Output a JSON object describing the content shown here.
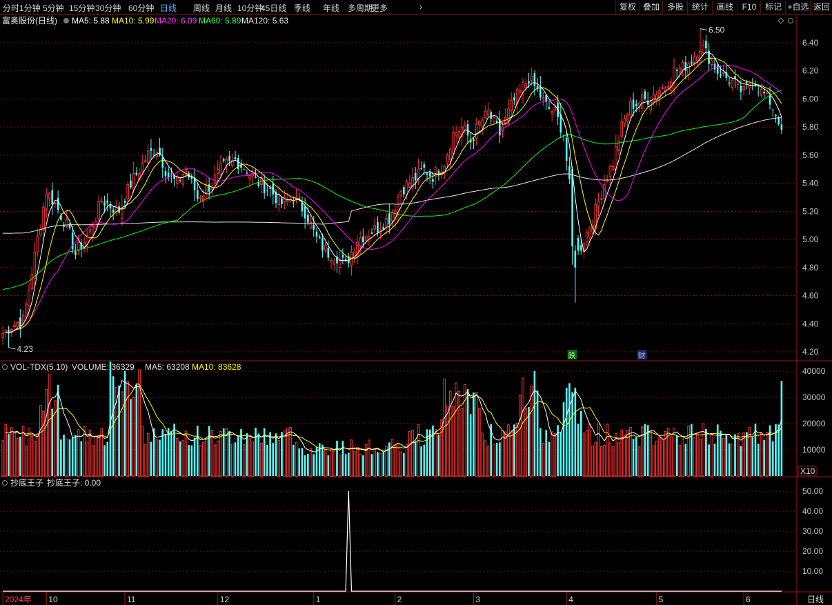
{
  "toolbar": {
    "periods": [
      "分时",
      "1分钟",
      "5分钟",
      "15分钟",
      "30分钟",
      "60分钟",
      "日线",
      "周线",
      "月线",
      "10分钟",
      "45日线",
      "季线",
      "年线",
      "多周期",
      "更多"
    ],
    "active_period": "日线",
    "buttons": [
      "复权",
      "叠加",
      "多股",
      "统计",
      "画线",
      "F10",
      "标记",
      "+自选",
      "返回"
    ]
  },
  "colors": {
    "up": "#ff3232",
    "down": "#54ffff",
    "ma5": "#ffffff",
    "ma10": "#ffff00",
    "ma20": "#ff00ff",
    "ma60": "#00ff00",
    "ma120": "#e8e8e8",
    "grid": "#7a1010",
    "axis_text": "#c8c8c8"
  },
  "price_panel": {
    "title": "富奥股份(日线)",
    "indicators": [
      {
        "label": "MA5: 5.88",
        "color": "#ffffff"
      },
      {
        "label": "MA10: 5.99",
        "color": "#ffff00"
      },
      {
        "label": "MA20: 6.09",
        "color": "#ff33ff"
      },
      {
        "label": "MA60: 5.89",
        "color": "#33ff33"
      },
      {
        "label": "MA120: 5.63",
        "color": "#e8e8e8"
      }
    ],
    "axis_ticks": [
      "6.40",
      "6.20",
      "6.00",
      "5.80",
      "5.60",
      "5.40",
      "5.20",
      "5.00",
      "4.80",
      "4.60",
      "4.40",
      "4.20"
    ],
    "high_label": "6.50",
    "low_label": "4.23",
    "event_tags": [
      {
        "text": "跌",
        "index": 196
      },
      {
        "text": "财",
        "index": 220
      }
    ]
  },
  "volume_panel": {
    "title": "VOL-TDX(5,10)",
    "indicators": [
      {
        "label": "VOLUME: 36329",
        "color": "#e0e0e0"
      },
      {
        "label": "MA5: 63208",
        "color": "#e0e0e0"
      },
      {
        "label": "MA10: 83628",
        "color": "#ffff00"
      }
    ],
    "axis_ticks": [
      "40000",
      "30000",
      "20000",
      "10000"
    ],
    "unit_label": "X10"
  },
  "indicator_panel": {
    "title": "抄底王子",
    "indicators": [
      {
        "label": "抄底王子: 0.00",
        "color": "#e0e0e0"
      }
    ],
    "axis_ticks": [
      "50.00",
      "40.00",
      "30.00",
      "20.00",
      "10.00"
    ]
  },
  "bottom_axis": {
    "labels": [
      {
        "text": "2024年",
        "index": 0
      },
      {
        "text": "10",
        "index": 15
      },
      {
        "text": "11",
        "index": 42
      },
      {
        "text": "12",
        "index": 74
      },
      {
        "text": "1",
        "index": 107
      },
      {
        "text": "2",
        "index": 135
      },
      {
        "text": "3",
        "index": 162
      },
      {
        "text": "4",
        "index": 194
      },
      {
        "text": "5",
        "index": 225
      },
      {
        "text": "6",
        "index": 255
      }
    ],
    "period_label": "日线"
  },
  "chart_data": {
    "type": "candlestick",
    "title": "富奥股份(日线)",
    "price_range": [
      4.18,
      6.55
    ],
    "volume_range": [
      0,
      42000
    ],
    "indicator_range": [
      0,
      55
    ],
    "anchors": [
      [
        0,
        4.33
      ],
      [
        4,
        4.4
      ],
      [
        7,
        4.42
      ],
      [
        12,
        5.0
      ],
      [
        15,
        5.35
      ],
      [
        18,
        5.25
      ],
      [
        22,
        5.1
      ],
      [
        25,
        4.9
      ],
      [
        30,
        5.05
      ],
      [
        34,
        5.28
      ],
      [
        40,
        5.2
      ],
      [
        44,
        5.4
      ],
      [
        50,
        5.6
      ],
      [
        53,
        5.65
      ],
      [
        57,
        5.45
      ],
      [
        60,
        5.4
      ],
      [
        63,
        5.5
      ],
      [
        67,
        5.3
      ],
      [
        72,
        5.4
      ],
      [
        76,
        5.52
      ],
      [
        80,
        5.56
      ],
      [
        84,
        5.5
      ],
      [
        87,
        5.42
      ],
      [
        92,
        5.35
      ],
      [
        96,
        5.25
      ],
      [
        100,
        5.3
      ],
      [
        104,
        5.2
      ],
      [
        108,
        5.0
      ],
      [
        112,
        4.9
      ],
      [
        115,
        4.88
      ],
      [
        118,
        4.82
      ],
      [
        122,
        5.0
      ],
      [
        126,
        5.05
      ],
      [
        130,
        5.1
      ],
      [
        133,
        5.15
      ],
      [
        137,
        5.35
      ],
      [
        141,
        5.42
      ],
      [
        145,
        5.5
      ],
      [
        148,
        5.45
      ],
      [
        152,
        5.55
      ],
      [
        155,
        5.75
      ],
      [
        158,
        5.8
      ],
      [
        161,
        5.7
      ],
      [
        164,
        5.82
      ],
      [
        167,
        5.9
      ],
      [
        171,
        5.75
      ],
      [
        175,
        5.95
      ],
      [
        178,
        6.05
      ],
      [
        181,
        6.15
      ],
      [
        184,
        6.05
      ],
      [
        187,
        5.95
      ],
      [
        190,
        5.9
      ],
      [
        193,
        5.75
      ],
      [
        196,
        5.2
      ],
      [
        198,
        4.9
      ],
      [
        201,
        5.05
      ],
      [
        204,
        5.2
      ],
      [
        207,
        5.4
      ],
      [
        210,
        5.55
      ],
      [
        213,
        5.8
      ],
      [
        216,
        5.95
      ],
      [
        219,
        5.98
      ],
      [
        222,
        6.0
      ],
      [
        225,
        6.05
      ],
      [
        228,
        6.1
      ],
      [
        231,
        6.2
      ],
      [
        234,
        6.22
      ],
      [
        237,
        6.28
      ],
      [
        240,
        6.38
      ],
      [
        243,
        6.3
      ],
      [
        246,
        6.2
      ],
      [
        249,
        6.15
      ],
      [
        252,
        6.1
      ],
      [
        255,
        6.05
      ],
      [
        258,
        6.15
      ],
      [
        261,
        6.05
      ],
      [
        264,
        5.98
      ],
      [
        267,
        5.85
      ],
      [
        268,
        5.78
      ]
    ],
    "last_bar": {
      "close": 5.78,
      "volume": 36329
    },
    "ma_last": {
      "MA5": 5.88,
      "MA10": 5.99,
      "MA20": 6.09,
      "MA60": 5.89,
      "MA120": 5.63
    },
    "high": 6.5,
    "low": 4.23,
    "bars": 269,
    "indicator_spike": {
      "index": 119,
      "value": 50
    }
  }
}
